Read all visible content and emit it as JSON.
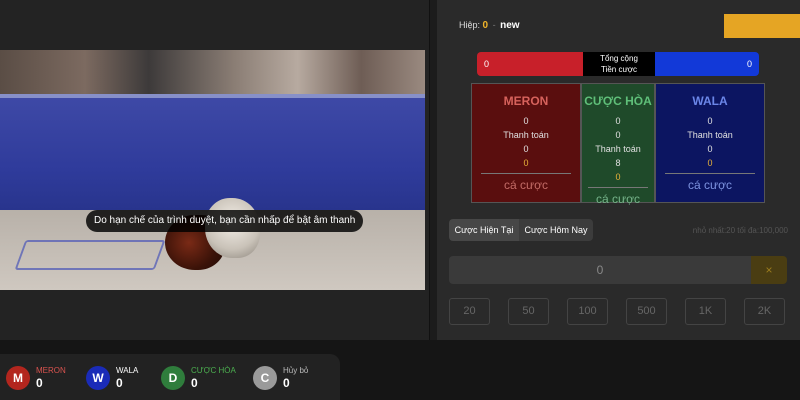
{
  "video": {
    "sound_notice": "Do hạn chế của trình duyệt, bạn cần nhấp để bật âm thanh"
  },
  "round": {
    "label": "Hiệp:",
    "number": "0",
    "separator": "-",
    "status": "new"
  },
  "totals": {
    "meron_total": "0",
    "center_label_line1": "Tổng cộng",
    "center_label_line2": "Tiền cược",
    "wala_total": "0"
  },
  "cards": {
    "meron": {
      "title": "MERON",
      "amount": "0",
      "payout_label": "Thanh toán",
      "payout": "0",
      "payout_rate": "0",
      "bet_label": "cá cược"
    },
    "draw": {
      "title": "CƯỢC HÒA",
      "amount": "0",
      "amount2": "0",
      "payout_label": "Thanh toán",
      "payout": "8",
      "payout_rate": "0",
      "bet_label": "cá cược"
    },
    "wala": {
      "title": "WALA",
      "amount": "0",
      "payout_label": "Thanh toán",
      "payout": "0",
      "payout_rate": "0",
      "bet_label": "cá cược"
    }
  },
  "tabs": [
    "Cược Hiện Tại",
    "Cược Hôm Nay"
  ],
  "limits": "nhỏ nhất:20 tối đa:100,000",
  "bet_input": {
    "value": "0",
    "clear_icon": "×"
  },
  "chips": [
    "20",
    "50",
    "100",
    "500",
    "1K",
    "2K"
  ],
  "stats": [
    {
      "letter": "M",
      "label": "MERON",
      "value": "0",
      "color": "#b3261e",
      "label_color": "#d9534f"
    },
    {
      "letter": "W",
      "label": "WALA",
      "value": "0",
      "color": "#1a2bb8",
      "label_color": "#ffffff"
    },
    {
      "letter": "D",
      "label": "CƯỢC HÒA",
      "value": "0",
      "color": "#2f7d3c",
      "label_color": "#4caf50"
    },
    {
      "letter": "C",
      "label": "Hủy bỏ",
      "value": "0",
      "color": "#9a9a9a",
      "label_color": "#bbbbbb"
    }
  ]
}
